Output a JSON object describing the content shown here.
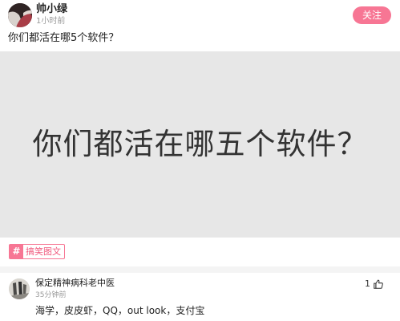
{
  "post": {
    "author": "帅小绿",
    "time": "1小时前",
    "follow_label": "关注",
    "title": "你们都活在哪5个软件？",
    "image_text": "你们都活在哪五个软件？",
    "tag": {
      "icon": "#",
      "label": "搞笑图文"
    }
  },
  "comment": {
    "author": "保定精神病科老中医",
    "time": "35分钟前",
    "like_count": "1",
    "text": "海学，皮皮虾，QQ，out look，支付宝"
  },
  "icons": {
    "tag": "hash-icon",
    "like": "thumb-up-icon"
  },
  "colors": {
    "accent": "#f77694",
    "image_background": "#e7e7e7"
  }
}
